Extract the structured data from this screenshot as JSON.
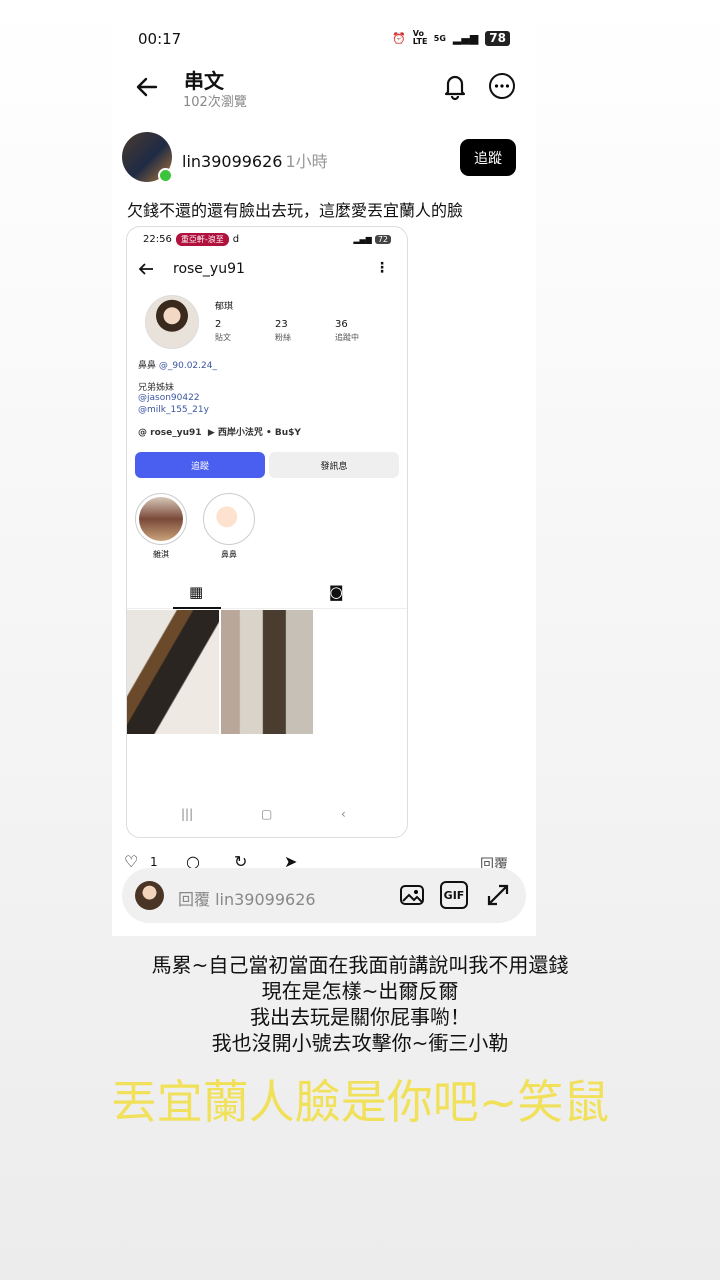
{
  "status_bar": {
    "time": "00:17",
    "volte": "Vo LTE",
    "net": "5G",
    "battery": "78"
  },
  "header": {
    "title": "串文",
    "views": "102次瀏覽"
  },
  "post": {
    "username": "lin39099626",
    "time": "1小時",
    "follow_label": "追蹤",
    "text": "欠錢不還的還有臉出去玩，這麼愛丟宜蘭人的臉",
    "like_count": "1",
    "reply_label": "回覆"
  },
  "screenshot": {
    "time": "22:56",
    "pill": "重亞軒-浪至",
    "pill_extra": "d",
    "battery": "72",
    "username": "rose_yu91",
    "display_name": "郁琪",
    "stats": [
      {
        "value": "2",
        "label": "貼文"
      },
      {
        "value": "23",
        "label": "粉絲"
      },
      {
        "value": "36",
        "label": "追蹤中"
      }
    ],
    "bio_prefix": "鼻鼻",
    "bio_tag": "@_90.02.24_",
    "bio_line2": "兄弟姊妹",
    "link1": "@jason90422",
    "link2": "@milk_155_21y",
    "threads_handle": "rose_yu91",
    "music": "西岸小法咒 • Bu$Y",
    "follow_btn": "追蹤",
    "message_btn": "發訊息",
    "highlights": [
      "雜淇",
      "鼻鼻"
    ]
  },
  "reply": {
    "placeholder": "回覆 lin39099626",
    "gif_label": "GIF"
  },
  "captions": [
    "馬累~自己當初當面在我面前講說叫我不用還錢",
    "現在是怎樣~出爾反爾",
    "我出去玩是關你屁事喲！",
    "我也沒開小號去攻擊你~衝三小勒"
  ],
  "big_caption": "丟宜蘭人臉是你吧~笑鼠",
  "colors": {
    "accent_blue": "#4a5ff0",
    "online_green": "#3cc43c",
    "big_caption": "#f0e05a"
  }
}
